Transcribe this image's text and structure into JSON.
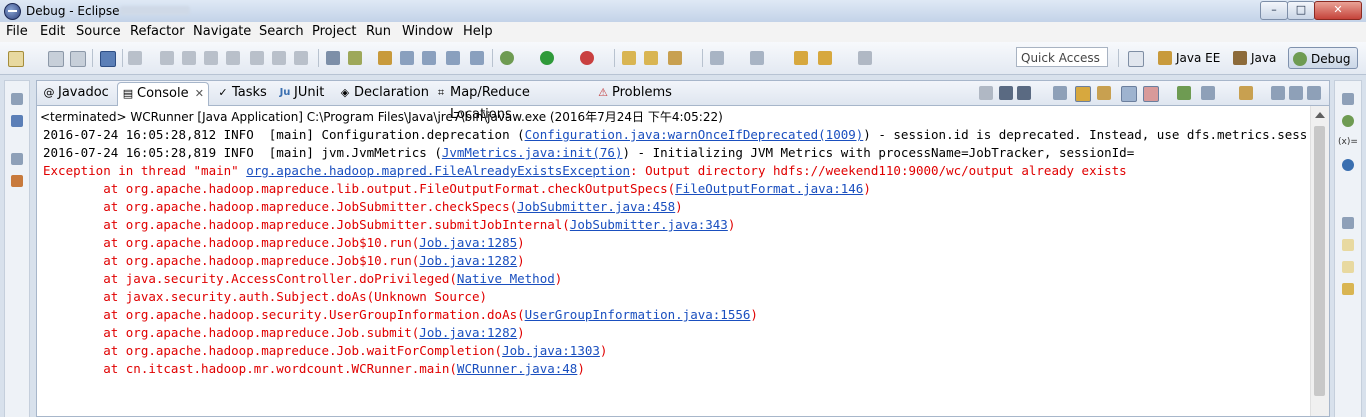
{
  "window": {
    "title": "Debug - Eclipse",
    "min": "–",
    "max": "□",
    "close": "✕"
  },
  "menu": [
    "File",
    "Edit",
    "Source",
    "Refactor",
    "Navigate",
    "Search",
    "Project",
    "Run",
    "Window",
    "Help"
  ],
  "toolbar": {
    "quick_access_placeholder": "Quick Access"
  },
  "perspectives": [
    {
      "label": "Java EE",
      "active": false
    },
    {
      "label": "Java",
      "active": false
    },
    {
      "label": "Debug",
      "active": true
    }
  ],
  "tabs": [
    {
      "label": "Javadoc",
      "icon": "@"
    },
    {
      "label": "Console",
      "icon": "▤",
      "active": true
    },
    {
      "label": "Tasks",
      "icon": "✓"
    },
    {
      "label": "JUnit",
      "icon": "Ju"
    },
    {
      "label": "Declaration",
      "icon": "◈"
    },
    {
      "label": "Map/Reduce Locations",
      "icon": "⌗"
    },
    {
      "label": "Problems",
      "icon": "⚠"
    }
  ],
  "console": {
    "status": "<terminated> WCRunner [Java Application] C:\\Program Files\\Java\\jre7\\bin\\javaw.exe (2016年7月24日 下午4:05:22)",
    "lines": [
      {
        "type": "info",
        "parts": [
          {
            "t": "2016-07-24 16:05:28,812 INFO  [main] Configuration.deprecation ("
          },
          {
            "t": "Configuration.java:warnOnceIfDeprecated(1009)",
            "link": true
          },
          {
            "t": ") - session.id is deprecated. Instead, use dfs.metrics.session-id"
          }
        ]
      },
      {
        "type": "info",
        "parts": [
          {
            "t": "2016-07-24 16:05:28,819 INFO  [main] jvm.JvmMetrics ("
          },
          {
            "t": "JvmMetrics.java:init(76)",
            "link": true
          },
          {
            "t": ") - Initializing JVM Metrics with processName=JobTracker, sessionId="
          }
        ]
      },
      {
        "type": "err",
        "parts": [
          {
            "t": "Exception in thread \"main\" "
          },
          {
            "t": "org.apache.hadoop.mapred.FileAlreadyExistsException",
            "link": true
          },
          {
            "t": ": Output directory hdfs://weekend110:9000/wc/output already exists"
          }
        ]
      },
      {
        "type": "err",
        "parts": [
          {
            "t": "\tat org.apache.hadoop.mapreduce.lib.output.FileOutputFormat.checkOutputSpecs("
          },
          {
            "t": "FileOutputFormat.java:146",
            "link": true
          },
          {
            "t": ")"
          }
        ]
      },
      {
        "type": "err",
        "parts": [
          {
            "t": "\tat org.apache.hadoop.mapreduce.JobSubmitter.checkSpecs("
          },
          {
            "t": "JobSubmitter.java:458",
            "link": true
          },
          {
            "t": ")"
          }
        ]
      },
      {
        "type": "err",
        "parts": [
          {
            "t": "\tat org.apache.hadoop.mapreduce.JobSubmitter.submitJobInternal("
          },
          {
            "t": "JobSubmitter.java:343",
            "link": true
          },
          {
            "t": ")"
          }
        ]
      },
      {
        "type": "err",
        "parts": [
          {
            "t": "\tat org.apache.hadoop.mapreduce.Job$10.run("
          },
          {
            "t": "Job.java:1285",
            "link": true
          },
          {
            "t": ")"
          }
        ]
      },
      {
        "type": "err",
        "parts": [
          {
            "t": "\tat org.apache.hadoop.mapreduce.Job$10.run("
          },
          {
            "t": "Job.java:1282",
            "link": true
          },
          {
            "t": ")"
          }
        ]
      },
      {
        "type": "err",
        "parts": [
          {
            "t": "\tat java.security.AccessController.doPrivileged("
          },
          {
            "t": "Native Method",
            "link": true
          },
          {
            "t": ")"
          }
        ]
      },
      {
        "type": "err",
        "parts": [
          {
            "t": "\tat javax.security.auth.Subject.doAs(Unknown Source)"
          }
        ]
      },
      {
        "type": "err",
        "parts": [
          {
            "t": "\tat org.apache.hadoop.security.UserGroupInformation.doAs("
          },
          {
            "t": "UserGroupInformation.java:1556",
            "link": true
          },
          {
            "t": ")"
          }
        ]
      },
      {
        "type": "err",
        "parts": [
          {
            "t": "\tat org.apache.hadoop.mapreduce.Job.submit("
          },
          {
            "t": "Job.java:1282",
            "link": true
          },
          {
            "t": ")"
          }
        ]
      },
      {
        "type": "err",
        "parts": [
          {
            "t": "\tat org.apache.hadoop.mapreduce.Job.waitForCompletion("
          },
          {
            "t": "Job.java:1303",
            "link": true
          },
          {
            "t": ")"
          }
        ]
      },
      {
        "type": "err",
        "parts": [
          {
            "t": "\tat cn.itcast.hadoop.mr.wordcount.WCRunner.main("
          },
          {
            "t": "WCRunner.java:48",
            "link": true
          },
          {
            "t": ")"
          }
        ]
      }
    ]
  },
  "right_trim": {
    "label": "(x)="
  },
  "colors": {
    "error": "#e00000",
    "link": "#1a4fbf",
    "accent": "#1e6bc4"
  }
}
